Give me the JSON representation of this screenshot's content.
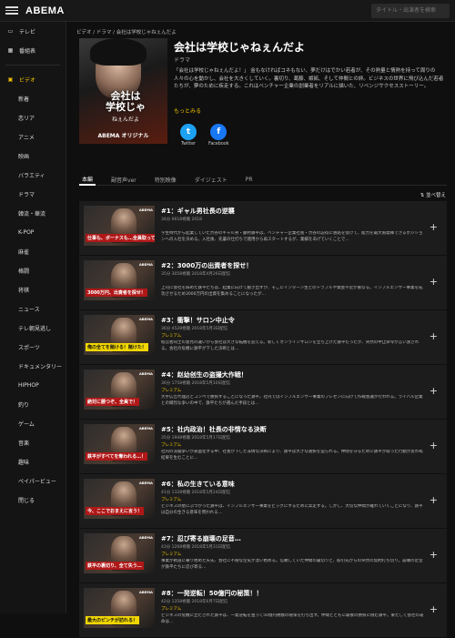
{
  "header": {
    "logo": "ABEMA",
    "search_placeholder": "タイトル・出演者を検索"
  },
  "sidebar": {
    "items": [
      {
        "label": "テレビ",
        "icon": "tv-icon"
      },
      {
        "label": "番組表",
        "icon": "calendar-icon"
      },
      {
        "label": "ビデオ",
        "icon": "video-icon",
        "active": true
      },
      {
        "label": "新着",
        "sub": true
      },
      {
        "label": "恋リア",
        "sub": true
      },
      {
        "label": "アニメ",
        "sub": true
      },
      {
        "label": "映画",
        "sub": true
      },
      {
        "label": "バラエティ",
        "sub": true
      },
      {
        "label": "ドラマ",
        "sub": true
      },
      {
        "label": "韓流・華流",
        "sub": true
      },
      {
        "label": "K-POP",
        "sub": true
      },
      {
        "label": "麻雀",
        "sub": true
      },
      {
        "label": "格闘",
        "sub": true
      },
      {
        "label": "将棋",
        "sub": true
      },
      {
        "label": "ニュース",
        "sub": true
      },
      {
        "label": "テレ朝見逃し",
        "sub": true
      },
      {
        "label": "スポーツ",
        "sub": true
      },
      {
        "label": "ドキュメンタリー",
        "sub": true
      },
      {
        "label": "HIPHOP",
        "sub": true
      },
      {
        "label": "釣り",
        "sub": true
      },
      {
        "label": "ゲーム",
        "sub": true
      },
      {
        "label": "音楽",
        "sub": true
      },
      {
        "label": "趣味",
        "sub": true
      },
      {
        "label": "ペイパービュー",
        "sub": true
      },
      {
        "label": "閉じる",
        "sub": true
      }
    ]
  },
  "breadcrumb": "ビデオ / ドラマ / 会社は学校じゃねぇんだよ",
  "series": {
    "poster_title": "会社は学校じゃねぇんだよ",
    "poster_line1": "会社は",
    "poster_line2": "学校じゃ",
    "poster_line3": "ねぇんだよ",
    "poster_brand": "ABEMA オリジナル",
    "title": "会社は学校じゃねぇんだよ",
    "genre": "ドラマ",
    "synopsis": "「会社は学校じゃねぇんだよ！」 金もなければコネもない、夢だけはでかい若者が、その熱量と情熱を持って周りの人々の心を動かし、会社を大きくしていく。裏切り、葛藤、嫉妬、そして仲間との絆。ビジネスの世界に飛び込んだ若者たちが、夢のために疾走する。これはベンチャー企業の創業者をリアルに描いた、リベンジサクセスストーリー。",
    "more_label": "もっとみる",
    "share": [
      {
        "label": "Twitter",
        "glyph": "t",
        "icon": "twitter-icon"
      },
      {
        "label": "Facebook",
        "glyph": "f",
        "icon": "facebook-icon"
      }
    ]
  },
  "tabs": [
    "本編",
    "副音声ver",
    "特別映像",
    "ダイジェスト",
    "PR"
  ],
  "sort_label": "並べ替え",
  "episodes": [
    {
      "title": "#1：ギャル男社長の逆襲",
      "meta": "34分 6618視聴 2018",
      "premium": "",
      "desc": "学生時代から起業していた渋谷のギャル男・藤村鉄平は、ベンチャー企業社長・渋谷の説得に感銘を受けて、能力を最大限発揮できるポジションへの入社を決める。入社後、先輩の仕打ちで雑用から再スタートするが、業績をあげていくことで…",
      "caption": "仕事も、ボーナスも…全員取ってやる！",
      "cap_yellow": false
    },
    {
      "title": "#2：3000万の出資者を探せ！",
      "meta": "35分 3058視聴 2018年4月26日配信",
      "premium": "",
      "desc": "上司に会社を辞めた鉄平たちは、起業に向けて動き出すが、そこにインターン生とのトラブルや資金不足が重なる。インフルエンサー事業を成功させるため3000万円の出資を集めることになったが…",
      "caption": "3000万円、出資者を探せ！",
      "cap_yellow": false
    },
    {
      "title": "#3：衝撃！サロン中止令",
      "meta": "36分 4528視聴 2018年5月3日配信",
      "premium": "プレミアム",
      "desc": "経営者同士の意見の違いから会社は大きな転機を迎える。新しくオンラインサロンを立ち上げた鉄平だったが、突然の中止命令が言い渡される。会社の危機に鉄平が下した決断とは…",
      "caption": "俺の全てを賭ける！賭けた！",
      "cap_yellow": true
    },
    {
      "title": "#4：赵幼创生の盗撮大作戦！",
      "meta": "36分 1758視聴 2018年5月10日配信",
      "premium": "プレミアム",
      "desc": "大手広告代理店とコンペで勝負することになった鉄平。社内ではインフルエンサー事業のプレゼンに向けて作戦会議が行われる。ライバル企業との熾烈な争いの中で、鉄平たちが選んだ手段とは…",
      "caption": "絶対に勝つぞ、全員で！",
      "cap_yellow": false
    },
    {
      "title": "#5：社内政治！社長の非情なる決断",
      "meta": "35分 1948視聴 2018年5月17日配信",
      "premium": "プレミアム",
      "desc": "社内の派閥争いが表面化する中、社長が下した非情な決断により、鉄平は大きな選択を迫られる。仲間を守るために鉄平が取った行動が思わぬ結果を生むことに…",
      "caption": "鉄平がすべてを奪われる…！",
      "cap_yellow": false
    },
    {
      "title": "#6：私の生きている意味",
      "meta": "41分 1328視聴 2018年5月24日配信",
      "premium": "プレミアム",
      "desc": "ビジネスの壁にぶつかった鉄平は、インフルエンサー事業をビッグにするために奔走する。しかし、大切な仲間が離れていくことになり、鉄平は自分の生きる意味を問われる…",
      "caption": "今、ここでおまえに言う！",
      "cap_yellow": false
    },
    {
      "title": "#7：忍び寄る崩壊の足音…",
      "meta": "43分 1268視聴 2018年5月31日配信",
      "premium": "プレミアム",
      "desc": "事業が軌道に乗り始めた矢先、会社に不穏な空気が漂い始める。信頼していた仲間の裏切りと、取引先からの突然の契約打ち切り。崩壊の足音が鉄平たちに忍び寄る…",
      "caption": "鉄平の裏切り、全て失う…",
      "cap_yellow": false
    },
    {
      "title": "#8：一発逆転！50億円の秘策！！",
      "meta": "42分 1358視聴 2018年6月7日配信",
      "premium": "プレミアム",
      "desc": "ビジネスの危機に立たされた鉄平は、一発逆転を狙って50億円規模の秘策を打ち出す。仲間とともに最後の勝負に挑む鉄平。果たして会社の運命は…",
      "caption": "最大のピンチが訪れる！",
      "cap_yellow": true
    }
  ],
  "colors": {
    "accent": "#f0c000",
    "twitter": "#1da1f2",
    "facebook": "#1877f2",
    "caption_red": "#b01818",
    "caption_yellow": "#f2d600"
  }
}
